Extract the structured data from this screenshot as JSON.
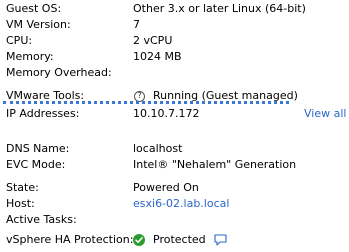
{
  "rows": {
    "guest_os": {
      "label": "Guest OS:",
      "value": "Other 3.x or later Linux (64-bit)"
    },
    "vm_version": {
      "label": "VM Version:",
      "value": "7"
    },
    "cpu": {
      "label": "CPU:",
      "value": "2 vCPU"
    },
    "memory": {
      "label": "Memory:",
      "value": "1024 MB"
    },
    "memory_overhead": {
      "label": "Memory Overhead:",
      "value": ""
    },
    "vmware_tools": {
      "label": "VMware Tools:",
      "value": "Running (Guest managed)",
      "icon": "question-circle-icon"
    },
    "ip_addresses": {
      "label": "IP Addresses:",
      "value": "10.10.7.172",
      "action": "View all"
    },
    "dns_name": {
      "label": "DNS Name:",
      "value": "localhost"
    },
    "evc_mode": {
      "label": "EVC Mode:",
      "value": "Intel® \"Nehalem\" Generation"
    },
    "state": {
      "label": "State:",
      "value": "Powered On"
    },
    "host": {
      "label": "Host:",
      "value": "esxi6-02.lab.local"
    },
    "active_tasks": {
      "label": "Active Tasks:",
      "value": ""
    },
    "ha_protection": {
      "label": "vSphere HA Protection:",
      "value": "Protected",
      "icon": "green-check-icon",
      "action_icon": "comment-bubble-icon"
    }
  },
  "colors": {
    "link": "#2a67c7",
    "status_green": "#2e9b2e",
    "separator": "#3a78d4"
  }
}
